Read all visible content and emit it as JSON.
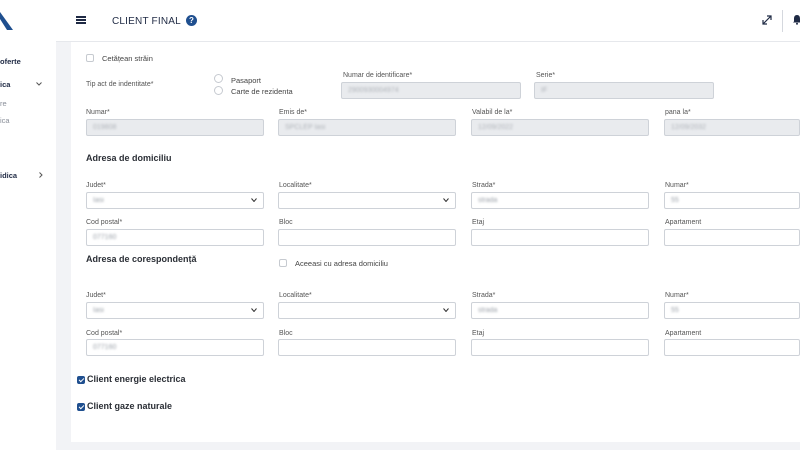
{
  "sidebar": {
    "items": [
      {
        "label": "oferte"
      },
      {
        "label": "ica"
      },
      {
        "label": "re"
      },
      {
        "label": "ica"
      },
      {
        "label": "idica"
      }
    ]
  },
  "header": {
    "title": "CLIENT FINAL",
    "help_glyph": "?"
  },
  "form": {
    "foreign_citizen_label": "Cetățean străin",
    "id_type_label": "Tip act de indentitate*",
    "id_options": [
      "Pasaport",
      "Carte de rezidenta"
    ],
    "id_number_label": "Numar de identificare*",
    "id_number_value": "2900930004974",
    "series_label": "Serie*",
    "series_value": "IF",
    "doc_number_label": "Numar*",
    "doc_number_value": "019808",
    "issued_by_label": "Emis de*",
    "issued_by_value": "SPCLEP Iasi",
    "valid_from_label": "Valabil de la*",
    "valid_from_value": "12/09/2022",
    "valid_to_label": "pana la*",
    "valid_to_value": "12/09/2032",
    "domicile": {
      "title": "Adresa de domiciliu",
      "county_label": "Judet*",
      "county_value": "Iasi",
      "locality_label": "Localitate*",
      "locality_value": "",
      "street_label": "Strada*",
      "street_value": "strada",
      "number_label": "Numar*",
      "number_value": "55",
      "postal_label": "Cod postal*",
      "postal_value": "077160",
      "block_label": "Bloc",
      "floor_label": "Etaj",
      "apartment_label": "Apartament"
    },
    "correspondence": {
      "title": "Adresa de corespondență",
      "same_as_label": "Aceeasi cu adresa domiciliu",
      "county_label": "Judet*",
      "county_value": "Iasi",
      "locality_label": "Localitate*",
      "locality_value": "",
      "street_label": "Strada*",
      "street_value": "strada",
      "number_label": "Numar*",
      "number_value": "55",
      "postal_label": "Cod postal*",
      "postal_value": "077160",
      "block_label": "Bloc",
      "floor_label": "Etaj",
      "apartment_label": "Apartament"
    },
    "client_electricity_label": "Client energie electrica",
    "client_gas_label": "Client gaze naturale"
  },
  "colors": {
    "accent": "#1f4f8f",
    "page_bg": "#f2f3f6",
    "disabled_bg": "#e9ebee"
  },
  "icons": [
    "logo-icon",
    "menu-icon",
    "help-icon",
    "expand-icon",
    "bell-icon",
    "chevron-down-icon",
    "chevron-right-icon"
  ]
}
